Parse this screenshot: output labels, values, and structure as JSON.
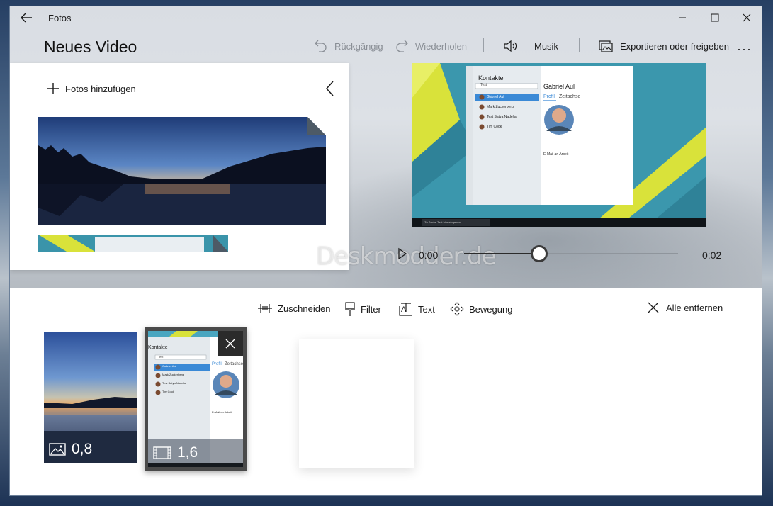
{
  "window": {
    "title": "Fotos"
  },
  "page": {
    "title": "Neues Video"
  },
  "commands": {
    "undo": "Rückgängig",
    "redo": "Wiederholen",
    "music": "Musik",
    "export": "Exportieren oder freigeben",
    "more": "···"
  },
  "library": {
    "add_photos": "Fotos hinzufügen"
  },
  "preview": {
    "contacts_title": "Kontakte",
    "search_placeholder": "Test",
    "contacts": [
      "Gabriel Aul",
      "Mark Zuckerberg",
      "Test Satya Nadella",
      "Tim Cook"
    ],
    "selected_contact": "Gabriel Aul",
    "tabs": [
      "Profil",
      "Zeitachse"
    ],
    "email_label": "E-Mail an Arbeit",
    "taskbar_search": "Zu Suche Text hier eingeben"
  },
  "playback": {
    "current_time": "0:00",
    "end_time": "0:02",
    "progress_fraction": 0.35
  },
  "watermark": "Deskmodder.de",
  "storyboard": {
    "tools": {
      "trim": "Zuschneiden",
      "filter": "Filter",
      "text": "Text",
      "motion": "Bewegung",
      "remove_all": "Alle entfernen"
    },
    "cards": [
      {
        "type": "image-icon",
        "duration": "0,8"
      },
      {
        "type": "video-icon",
        "duration": "1,6",
        "contacts_title": "Kontakte",
        "search_placeholder": "Test",
        "contacts": [
          "Gabriel Aul",
          "Mark Zuckerberg",
          "Test Satya Nadella",
          "Tim Cook"
        ],
        "selected_contact": "Gabriel Aul",
        "tabs": [
          "Profil",
          "Zeitachse"
        ],
        "email_label": "E-Mail an Arbeit"
      }
    ]
  },
  "colors": {
    "accent_blue": "#0078d7",
    "dark": "#2b2b2b",
    "preview_teal": "#3a94aa",
    "preview_yellow": "#d9e23a"
  }
}
